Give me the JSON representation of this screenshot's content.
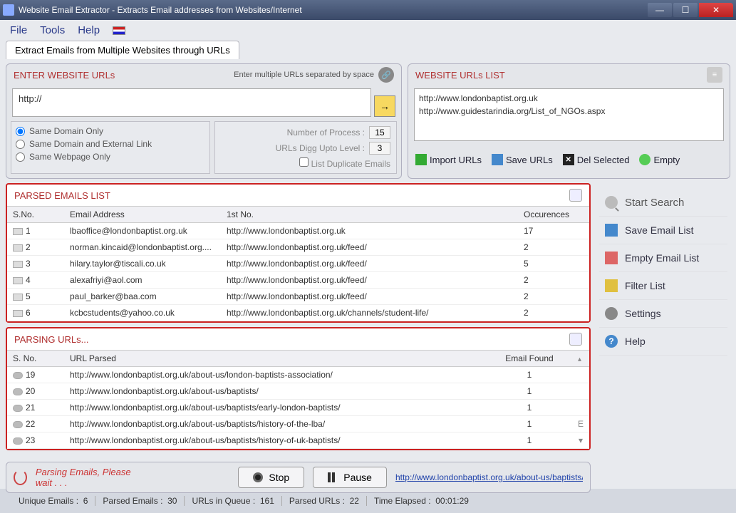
{
  "window": {
    "title": "Website Email Extractor - Extracts Email addresses from Websites/Internet"
  },
  "menu": {
    "file": "File",
    "tools": "Tools",
    "help": "Help"
  },
  "tab": {
    "main": "Extract Emails from Multiple Websites through URLs"
  },
  "enter_urls": {
    "header": "ENTER WEBSITE URLs",
    "hint": "Enter multiple URLs separated by space",
    "input_value": "http://",
    "radios": {
      "same_domain": "Same Domain Only",
      "same_domain_ext": "Same Domain and External Link",
      "same_webpage": "Same Webpage Only"
    },
    "num_process_label": "Number of Process :",
    "num_process_value": "15",
    "digg_label": "URLs Digg Upto Level :",
    "digg_value": "3",
    "dup_checkbox": "List Duplicate Emails"
  },
  "urls_list": {
    "header": "WEBSITE URLs LIST",
    "items": [
      "http://www.londonbaptist.org.uk",
      "http://www.guidestarindia.org/List_of_NGOs.aspx"
    ],
    "btns": {
      "import": "Import URLs",
      "save": "Save URLs",
      "del": "Del Selected",
      "empty": "Empty"
    }
  },
  "parsed_emails": {
    "header": "PARSED EMAILS LIST",
    "cols": {
      "sno": "S.No.",
      "email": "Email Address",
      "first": "1st No.",
      "occ": "Occurences"
    },
    "rows": [
      {
        "n": "1",
        "email": "lbaoffice@londonbaptist.org.uk",
        "first": "http://www.londonbaptist.org.uk",
        "occ": "17"
      },
      {
        "n": "2",
        "email": "norman.kincaid@londonbaptist.org....",
        "first": "http://www.londonbaptist.org.uk/feed/",
        "occ": "2"
      },
      {
        "n": "3",
        "email": "hilary.taylor@tiscali.co.uk",
        "first": "http://www.londonbaptist.org.uk/feed/",
        "occ": "5"
      },
      {
        "n": "4",
        "email": "alexafriyi@aol.com",
        "first": "http://www.londonbaptist.org.uk/feed/",
        "occ": "2"
      },
      {
        "n": "5",
        "email": "paul_barker@baa.com",
        "first": "http://www.londonbaptist.org.uk/feed/",
        "occ": "2"
      },
      {
        "n": "6",
        "email": "kcbcstudents@yahoo.co.uk",
        "first": "http://www.londonbaptist.org.uk/channels/student-life/",
        "occ": "2"
      }
    ]
  },
  "parsing_urls": {
    "header": "PARSING URLs...",
    "cols": {
      "sno": "S. No.",
      "url": "URL Parsed",
      "found": "Email Found"
    },
    "rows": [
      {
        "n": "19",
        "url": "http://www.londonbaptist.org.uk/about-us/london-baptists-association/",
        "found": "1"
      },
      {
        "n": "20",
        "url": "http://www.londonbaptist.org.uk/about-us/baptists/",
        "found": "1"
      },
      {
        "n": "21",
        "url": "http://www.londonbaptist.org.uk/about-us/baptists/early-london-baptists/",
        "found": "1"
      },
      {
        "n": "22",
        "url": "http://www.londonbaptist.org.uk/about-us/baptists/history-of-the-lba/",
        "found": "1"
      },
      {
        "n": "23",
        "url": "http://www.londonbaptist.org.uk/about-us/baptists/history-of-uk-baptists/",
        "found": "1"
      }
    ]
  },
  "side": {
    "start": "Start Search",
    "save": "Save Email List",
    "empty": "Empty Email List",
    "filter": "Filter List",
    "settings": "Settings",
    "help": "Help"
  },
  "ctrl": {
    "parsing": "Parsing Emails, Please wait . . .",
    "stop": "Stop",
    "pause": "Pause",
    "current_url": "http://www.londonbaptist.org.uk/about-us/baptists/history-of-"
  },
  "status": {
    "unique_label": "Unique Emails :",
    "unique": "6",
    "parsed_label": "Parsed Emails :",
    "parsed": "30",
    "queue_label": "URLs in Queue :",
    "queue": "161",
    "parsed_urls_label": "Parsed URLs :",
    "parsed_urls": "22",
    "elapsed_label": "Time Elapsed :",
    "elapsed": "00:01:29"
  }
}
